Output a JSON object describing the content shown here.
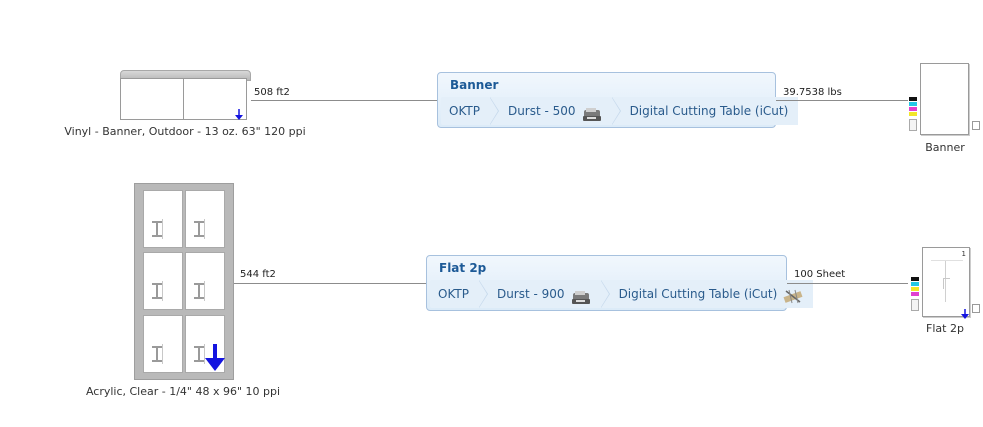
{
  "jobs": [
    {
      "material_label": "Vinyl - Banner, Outdoor - 13 oz. 63\" 120 ppi",
      "material_qty": "508 ft2",
      "workflow": {
        "title": "Banner",
        "steps": [
          {
            "label": "OKTP",
            "icon": ""
          },
          {
            "label": "Durst - 500",
            "icon": "printer-icon"
          },
          {
            "label": "Digital Cutting Table (iCut)",
            "icon": ""
          }
        ]
      },
      "output_qty": "39.7538 lbs",
      "output_label": "Banner"
    },
    {
      "material_label": "Acrylic, Clear - 1/4\" 48 x 96\" 10 ppi",
      "material_qty": "544 ft2",
      "workflow": {
        "title": "Flat 2p",
        "steps": [
          {
            "label": "OKTP",
            "icon": ""
          },
          {
            "label": "Durst - 900",
            "icon": "printer-icon"
          },
          {
            "label": "Digital Cutting Table (iCut)",
            "icon": "cutter-icon"
          }
        ]
      },
      "output_qty": "100 Sheet",
      "output_label": "Flat 2p",
      "output_page_number": "1"
    }
  ],
  "colors": {
    "accent_blue": "#1d5a97",
    "ink_cyan": "#22c8e6",
    "ink_magenta": "#e040d0",
    "ink_yellow": "#f2e629",
    "ink_black": "#111111",
    "arrow_blue": "#1414e0"
  }
}
